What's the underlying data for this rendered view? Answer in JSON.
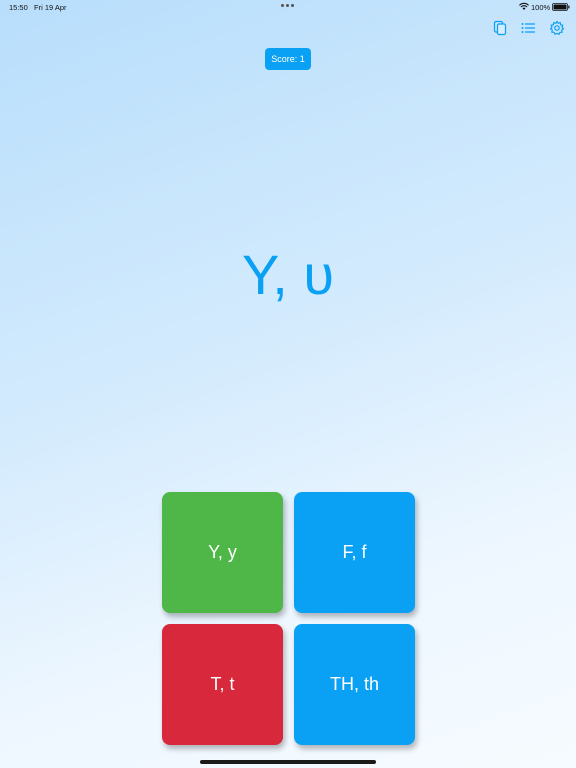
{
  "status_bar": {
    "time": "15:50",
    "date": "Fri 19 Apr",
    "battery": "100%"
  },
  "toolbar": {
    "icons": [
      "cards-icon",
      "list-icon",
      "gear-icon"
    ],
    "accent_color": "#0aa1f5"
  },
  "score": {
    "label": "Score: 1"
  },
  "prompt": {
    "letter": "Υ, υ"
  },
  "answers": [
    {
      "label": "Y, y",
      "color": "#4fb748"
    },
    {
      "label": "F, f",
      "color": "#0aa1f5"
    },
    {
      "label": "T, t",
      "color": "#d8283c"
    },
    {
      "label": "TH, th",
      "color": "#0aa1f5"
    }
  ]
}
